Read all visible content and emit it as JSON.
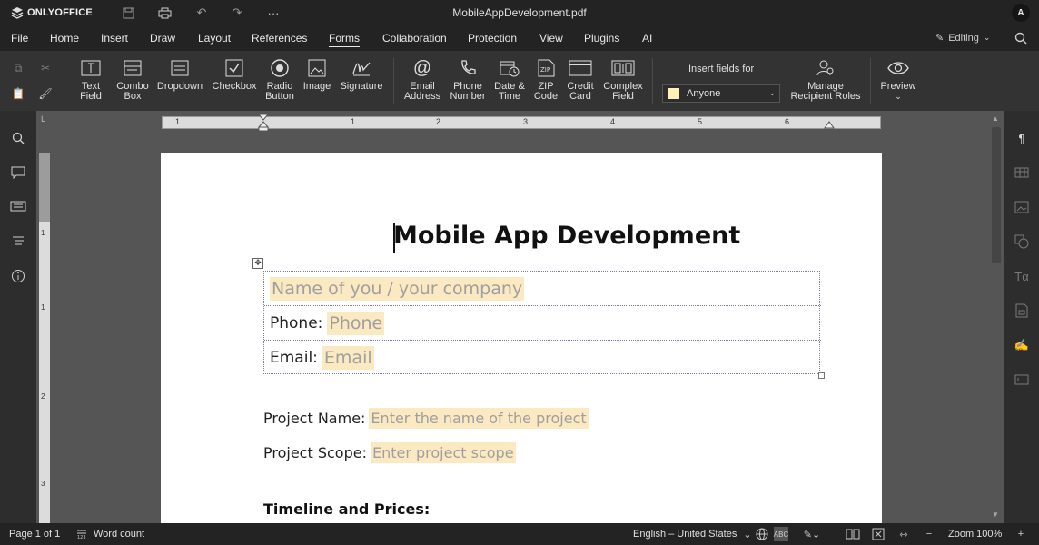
{
  "app": {
    "brand": "ONLYOFFICE",
    "file_name": "MobileAppDevelopment.pdf",
    "avatar_initial": "A"
  },
  "menu": {
    "items": [
      "File",
      "Home",
      "Insert",
      "Draw",
      "Layout",
      "References",
      "Forms",
      "Collaboration",
      "Protection",
      "View",
      "Plugins",
      "AI"
    ],
    "active": "Forms",
    "mode_label": "Editing"
  },
  "toolbar": {
    "text_field": {
      "l1": "Text",
      "l2": "Field"
    },
    "combo_box": {
      "l1": "Combo",
      "l2": "Box"
    },
    "dropdown": {
      "l1": "Dropdown"
    },
    "checkbox": {
      "l1": "Checkbox"
    },
    "radio_button": {
      "l1": "Radio",
      "l2": "Button"
    },
    "image": {
      "l1": "Image"
    },
    "signature": {
      "l1": "Signature"
    },
    "email_address": {
      "l1": "Email",
      "l2": "Address"
    },
    "phone_number": {
      "l1": "Phone",
      "l2": "Number"
    },
    "date_time": {
      "l1": "Date &",
      "l2": "Time"
    },
    "zip_code": {
      "l1": "ZIP",
      "l2": "Code"
    },
    "credit_card": {
      "l1": "Credit",
      "l2": "Card"
    },
    "complex_field": {
      "l1": "Complex",
      "l2": "Field"
    },
    "insert_fields_for_label": "Insert fields for",
    "recipient_selected": "Anyone",
    "manage_roles": {
      "l1": "Manage",
      "l2": "Recipient Roles"
    },
    "preview": {
      "l1": "Preview"
    }
  },
  "ruler": {
    "numbers": [
      "1",
      "1",
      "2",
      "3",
      "4",
      "5",
      "6"
    ]
  },
  "vruler": {
    "numbers": [
      "1",
      "1",
      "2",
      "3"
    ]
  },
  "document": {
    "heading": "Mobile App Development",
    "company_placeholder": "Name of you / your company",
    "phone_label": "Phone:",
    "phone_placeholder": "Phone",
    "email_label": "Email:",
    "email_placeholder": "Email",
    "project_name_label": "Project Name:",
    "project_name_placeholder": "Enter the name of the project",
    "project_scope_label": "Project Scope:",
    "project_scope_placeholder": "Enter project scope",
    "timeline_heading": "Timeline and Prices:"
  },
  "status": {
    "page": "Page 1 of 1",
    "word_count": "Word count",
    "language": "English – United States",
    "zoom": "Zoom 100%"
  },
  "colors": {
    "field_highlight": "#fbe9c2",
    "toolbar_bg": "#333333",
    "titlebar_bg": "#232323"
  }
}
